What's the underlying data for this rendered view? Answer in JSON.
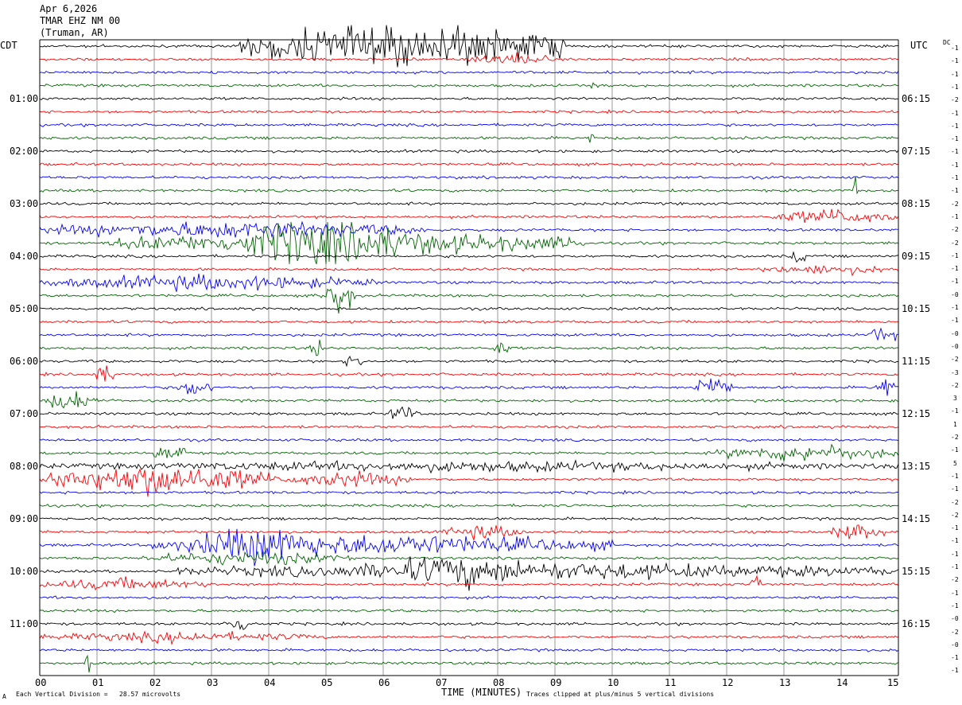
{
  "header": {
    "date": "Apr 6,2026",
    "station": "TMAR EHZ NM 00",
    "location": "(Truman, AR)"
  },
  "chart_data": {
    "type": "line",
    "left_label": "CDT",
    "right_label": "UTC",
    "dc_label": "DC",
    "xlabel": "TIME (MINUTES)",
    "xlim": [
      0,
      15
    ],
    "x_ticks": [
      "00",
      "01",
      "02",
      "03",
      "04",
      "05",
      "06",
      "07",
      "08",
      "09",
      "10",
      "11",
      "12",
      "13",
      "14",
      "15"
    ],
    "left_time_labels": [
      "01:00",
      "02:00",
      "03:00",
      "04:00",
      "05:00",
      "06:00",
      "07:00",
      "08:00",
      "09:00",
      "10:00",
      "11:00"
    ],
    "right_time_labels": [
      "06:15",
      "07:15",
      "08:15",
      "09:15",
      "10:15",
      "11:15",
      "12:15",
      "13:15",
      "14:15",
      "15:15",
      "16:15"
    ],
    "trace_colors": [
      "#000000",
      "#ff0000",
      "#0000ff",
      "#006400"
    ],
    "dc_offsets": [
      "-1",
      "-1",
      "-1",
      "-1",
      "-2",
      "-1",
      "-1",
      "-1",
      "-1",
      "-1",
      "-1",
      "-1",
      "-2",
      "-1",
      "-2",
      "-2",
      "-1",
      "-1",
      "-1",
      "-0",
      "-1",
      "-1",
      "-0",
      "-0",
      "-2",
      "-3",
      "-2",
      "3",
      "-1",
      "1",
      "-2",
      "-1",
      "5",
      "-1",
      "-1",
      "-2",
      "-2",
      "-1",
      "-1",
      "-1",
      "-1",
      "-2",
      "-1",
      "-1",
      "-0",
      "-2",
      "-0",
      "-1",
      "-1",
      "-2"
    ],
    "footer_scale": "Each Vertical Division =   28.57 microvolts",
    "footer_clip": "Traces clipped at plus/minus 5 vertical divisions",
    "corner_mark": "A"
  }
}
